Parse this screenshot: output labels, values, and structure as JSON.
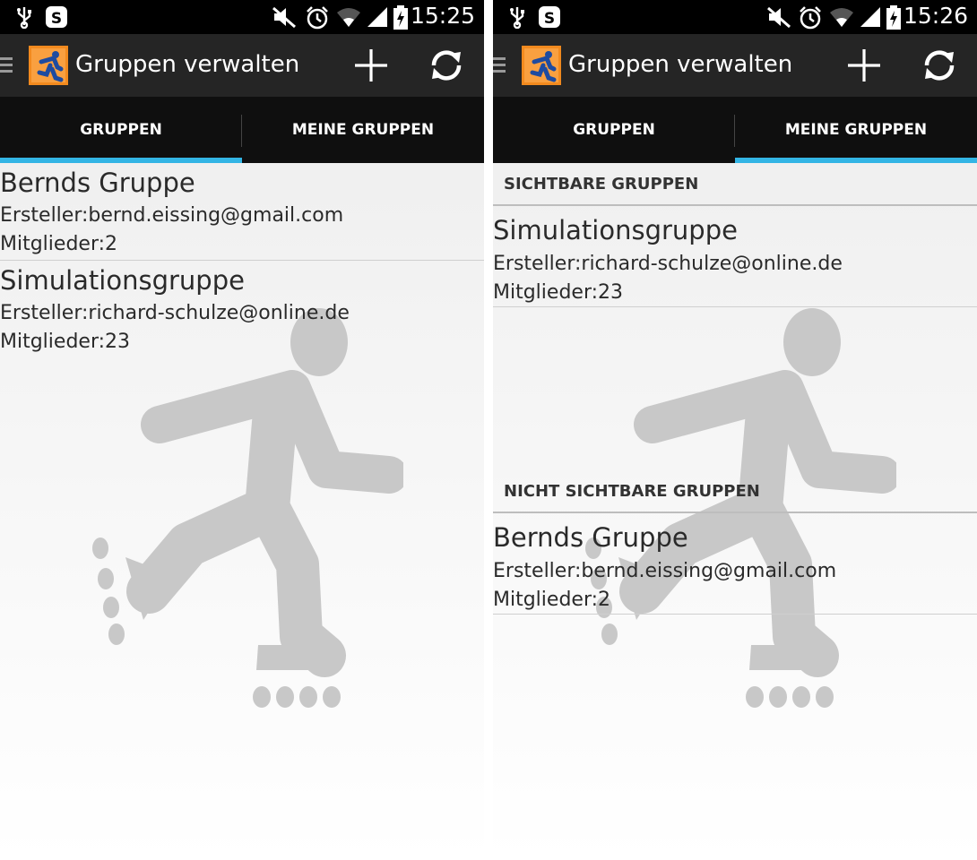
{
  "left_screen": {
    "status_bar": {
      "time": "15:25"
    },
    "action_bar": {
      "title": "Gruppen verwalten"
    },
    "tabs": [
      {
        "label": "GRUPPEN",
        "active": true
      },
      {
        "label": "MEINE GRUPPEN",
        "active": false
      }
    ],
    "groups": [
      {
        "name": "Bernds Gruppe",
        "creator": "Ersteller:bernd.eissing@gmail.com",
        "members": "Mitglieder:2"
      },
      {
        "name": "Simulationsgruppe",
        "creator": "Ersteller:richard-schulze@online.de",
        "members": "Mitglieder:23"
      }
    ]
  },
  "right_screen": {
    "status_bar": {
      "time": "15:26"
    },
    "action_bar": {
      "title": "Gruppen verwalten"
    },
    "tabs": [
      {
        "label": "GRUPPEN",
        "active": false
      },
      {
        "label": "MEINE GRUPPEN",
        "active": true
      }
    ],
    "visible_section": {
      "header": "SICHTBARE GRUPPEN",
      "groups": [
        {
          "name": "Simulationsgruppe",
          "creator": "Ersteller:richard-schulze@online.de",
          "members": "Mitglieder:23"
        }
      ]
    },
    "hidden_section": {
      "header": "NICHT SICHTBARE GRUPPEN",
      "groups": [
        {
          "name": "Bernds Gruppe",
          "creator": "Ersteller:bernd.eissing@gmail.com",
          "members": "Mitglieder:2"
        }
      ]
    }
  },
  "colors": {
    "tab_indicator": "#33b5e5",
    "action_bar": "#252525",
    "tab_bar": "#0f0f0f",
    "logo_orange": "#f28a1e",
    "logo_blue": "#1e4ba0"
  },
  "icons": [
    "usb-icon",
    "skype-icon",
    "mute-icon",
    "alarm-icon",
    "wifi-icon",
    "signal-icon",
    "battery-charging-icon",
    "drawer-icon",
    "app-logo",
    "add-icon",
    "refresh-icon",
    "inline-skater-watermark"
  ]
}
